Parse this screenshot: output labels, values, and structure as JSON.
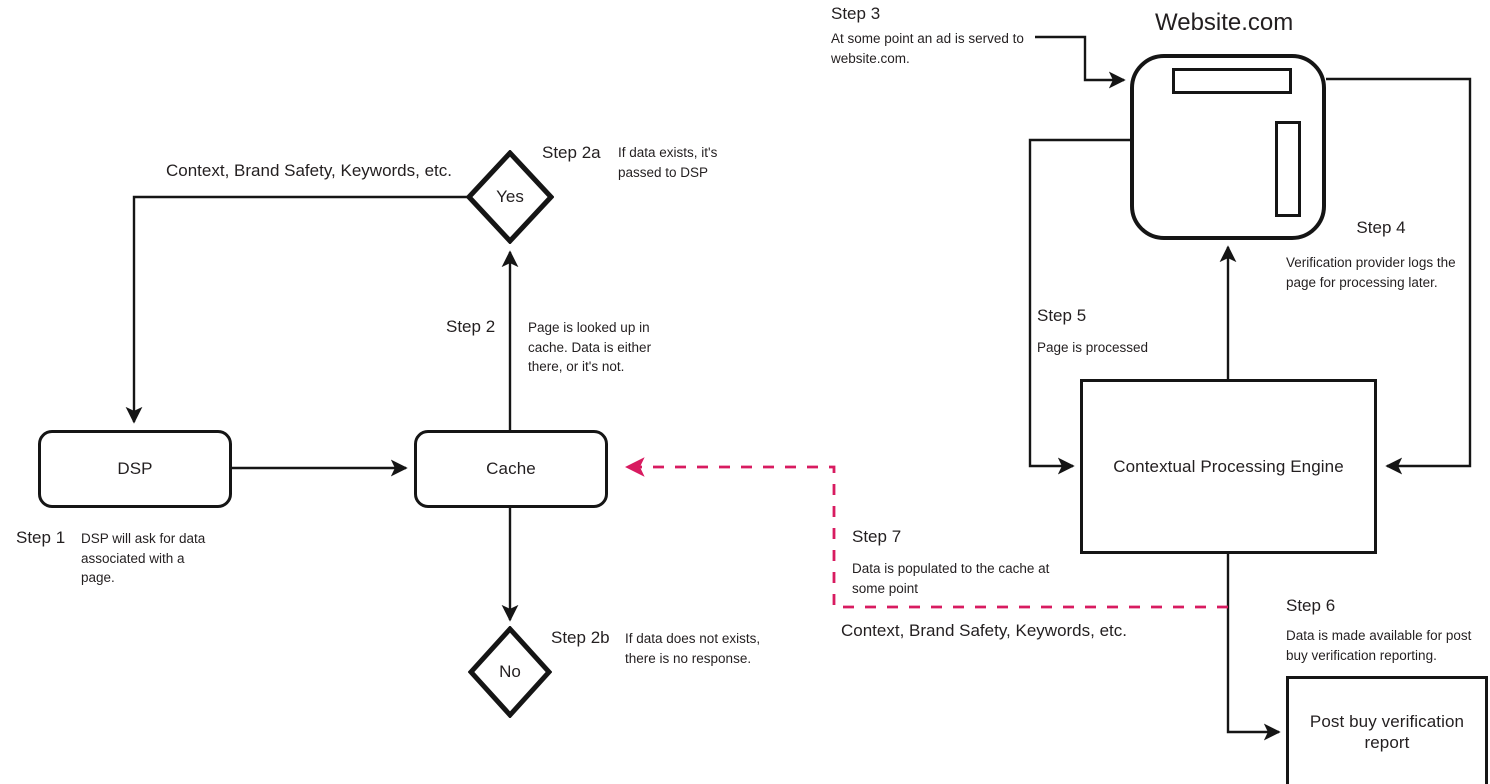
{
  "diagram": {
    "title": "Contextual data flow between DSP, cache, website and contextual processing engine",
    "accent_pink": "#D81B60",
    "line_black": "#151515"
  },
  "nodes": {
    "dsp": {
      "label": "DSP"
    },
    "cache": {
      "label": "Cache"
    },
    "yes": {
      "label": "Yes"
    },
    "no": {
      "label": "No"
    },
    "website": {
      "label": "Website.com"
    },
    "engine": {
      "label": "Contextual Processing Engine"
    },
    "report": {
      "label": "Post buy verification report"
    }
  },
  "steps": {
    "step1": {
      "title": "Step 1",
      "desc": "DSP will ask for data associated with a page."
    },
    "step2": {
      "title": "Step 2",
      "desc": "Page is looked up in cache. Data is either there, or it's not."
    },
    "step2a": {
      "title": "Step 2a",
      "desc": "If data exists, it's passed to DSP"
    },
    "step2b": {
      "title": "Step 2b",
      "desc": "If data does not exists, there is no response."
    },
    "step3": {
      "title": "Step 3",
      "desc": "At some point an ad is served to website.com."
    },
    "step4": {
      "title": "Step 4",
      "desc": "Verification provider logs the page for processing later."
    },
    "step5": {
      "title": "Step 5",
      "desc": "Page is processed"
    },
    "step6": {
      "title": "Step 6",
      "desc": "Data is made available for post buy verification reporting."
    },
    "step7": {
      "title": "Step 7",
      "desc": "Data is populated to the cache at some point"
    }
  },
  "wire_labels": {
    "context_left": "Context, Brand Safety, Keywords, etc.",
    "context_right": "Context, Brand Safety, Keywords, etc."
  }
}
